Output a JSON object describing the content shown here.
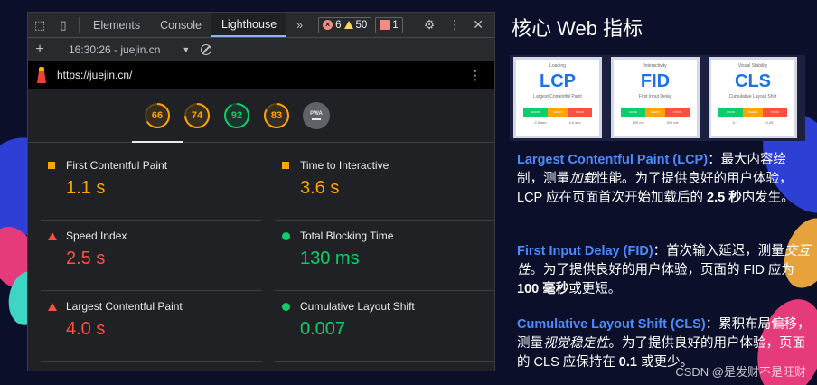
{
  "colors": {
    "accent": "#8ab4f8",
    "good": "#0cce6b",
    "average": "#ffa400",
    "poor": "#ff4e42",
    "highlight_text": "#4a8cff"
  },
  "devtools": {
    "tabs": [
      "Elements",
      "Console",
      "Lighthouse"
    ],
    "active_tab": "Lighthouse",
    "more_tabs_label": "»",
    "errors_count": "6",
    "warnings_count": "50",
    "issues_count": "1",
    "icons": [
      "inspect-icon",
      "device-toolbar-icon",
      "settings-icon",
      "more-icon",
      "close-icon"
    ]
  },
  "report_toolbar": {
    "new_report_label": "+",
    "report_selector": "16:30:26 - juejin.cn",
    "clear_icon": "block-icon"
  },
  "url_bar": {
    "url": "https://juejin.cn/"
  },
  "gauges": [
    {
      "score": 66,
      "status": "orange"
    },
    {
      "score": 74,
      "status": "orange"
    },
    {
      "score": 92,
      "status": "green"
    },
    {
      "score": 83,
      "status": "orange"
    },
    {
      "label": "PWA",
      "status": "na"
    }
  ],
  "metrics": [
    {
      "label": "First Contentful Paint",
      "value": "1.1 s",
      "rating": "average"
    },
    {
      "label": "Time to Interactive",
      "value": "3.6 s",
      "rating": "average"
    },
    {
      "label": "Speed Index",
      "value": "2.5 s",
      "rating": "poor"
    },
    {
      "label": "Total Blocking Time",
      "value": "130 ms",
      "rating": "good"
    },
    {
      "label": "Largest Contentful Paint",
      "value": "4.0 s",
      "rating": "poor"
    },
    {
      "label": "Cumulative Layout Shift",
      "value": "0.007",
      "rating": "good"
    }
  ],
  "panel": {
    "title": "核心 Web 指标",
    "thumbs": [
      {
        "top": "Loading",
        "big": "LCP",
        "sub": "Largest Contentful Paint",
        "ticks": [
          "2.5 sec",
          "4.0 sec"
        ],
        "bar_labels": [
          "GOOD",
          "NEEDS IMPROVEMENT",
          "POOR"
        ]
      },
      {
        "top": "Interactivity",
        "big": "FID",
        "sub": "First Input Delay",
        "ticks": [
          "100 ms",
          "300 ms"
        ],
        "bar_labels": [
          "GOOD",
          "NEEDS IMPROVEMENT",
          "POOR"
        ]
      },
      {
        "top": "Visual Stability",
        "big": "CLS",
        "sub": "Cumulative Layout Shift",
        "ticks": [
          "0.1",
          "0.25"
        ],
        "bar_labels": [
          "GOOD",
          "NEEDS IMPROVEMENT",
          "POOR"
        ]
      }
    ],
    "lcp": {
      "term": "Largest Contentful Paint (LCP)",
      "sep": "：",
      "text_a": "最大内容绘制，测量",
      "emph": "加载",
      "text_b": "性能。为了提供良好的用户体验，LCP 应在页面首次开始加载后的 ",
      "strong": "2.5 秒",
      "text_c": "内发生。"
    },
    "fid": {
      "term": "First Input Delay (FID)",
      "sep": "：",
      "text_a": "首次输入延迟，测量",
      "emph": "交互性",
      "text_b": "。为了提供良好的用户体验，页面的 FID 应为",
      "strong": "100 毫秒",
      "text_c": "或更短。"
    },
    "cls": {
      "term": "Cumulative Layout Shift (CLS)",
      "sep": "：",
      "text_a": "累积布局偏移，测量",
      "emph": "视觉稳定性",
      "text_b": "。为了提供良好的用户体验，页面的 CLS 应保持在 ",
      "strong": "0.1",
      "text_c": " 或更少。"
    }
  },
  "watermark": "CSDN @是发财不是旺财"
}
